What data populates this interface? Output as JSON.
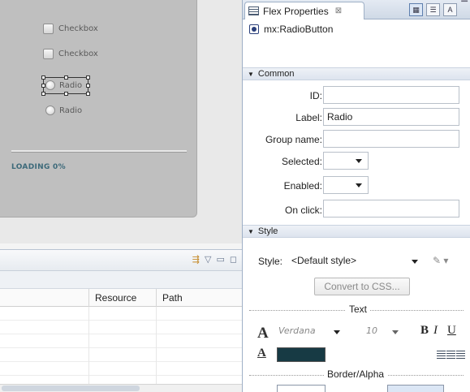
{
  "design": {
    "checkbox1": "Checkbox",
    "checkbox2": "Checkbox",
    "radio1": "Radio",
    "radio2": "Radio",
    "loading": "LOADING 0%"
  },
  "problems": {
    "columns": {
      "resource": "Resource",
      "path": "Path"
    }
  },
  "panel": {
    "tab_title": "Flex Properties",
    "tab_close": "⊠",
    "component": "mx:RadioButton",
    "common": {
      "title": "Common",
      "id_label": "ID:",
      "id_value": "",
      "label_label": "Label:",
      "label_value": "Radio",
      "group_label": "Group name:",
      "group_value": "",
      "selected_label": "Selected:",
      "enabled_label": "Enabled:",
      "onclick_label": "On click:",
      "onclick_value": ""
    },
    "style": {
      "title": "Style",
      "style_label": "Style:",
      "style_value": "<Default style>",
      "convert_button": "Convert to CSS...",
      "text_header": "Text",
      "font_name": "Verdana",
      "font_size": "10",
      "bold": "B",
      "italic": "I",
      "underline": "U",
      "text_color": "#173a44",
      "border_header": "Border/Alpha"
    }
  }
}
